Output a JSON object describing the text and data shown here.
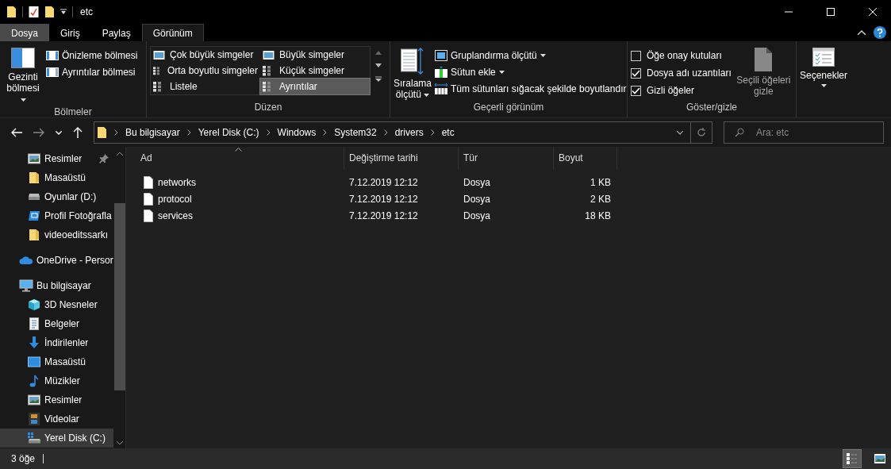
{
  "window": {
    "title": "etc"
  },
  "ribbon": {
    "tabs": [
      {
        "label": "Dosya",
        "kind": "file",
        "selected": false
      },
      {
        "label": "Giriş",
        "kind": "tab",
        "selected": false
      },
      {
        "label": "Paylaş",
        "kind": "tab",
        "selected": false
      },
      {
        "label": "Görünüm",
        "kind": "tab",
        "selected": true
      }
    ],
    "panes": {
      "label": "Bölmeler",
      "large_button": "Gezinti bölmesi",
      "buttons": [
        "Önizleme bölmesi",
        "Ayrıntılar bölmesi"
      ]
    },
    "layout": {
      "label": "Düzen",
      "options": [
        {
          "label": "Çok büyük simgeler",
          "selected": false
        },
        {
          "label": "Büyük simgeler",
          "selected": false
        },
        {
          "label": "Orta boyutlu simgeler",
          "selected": false
        },
        {
          "label": "Küçük simgeler",
          "selected": false
        },
        {
          "label": "Listele",
          "selected": false
        },
        {
          "label": "Ayrıntılar",
          "selected": true
        }
      ]
    },
    "current_view": {
      "label": "Geçerli görünüm",
      "large_button": "Sıralama ölçütü",
      "buttons": [
        {
          "label": "Gruplandırma ölçütü",
          "dropdown": true
        },
        {
          "label": "Sütun ekle",
          "dropdown": true
        },
        {
          "label": "Tüm sütunları sığacak şekilde boyutlandır",
          "dropdown": false
        }
      ]
    },
    "show_hide": {
      "label": "Göster/gizle",
      "checkboxes": [
        {
          "label": "Öğe onay kutuları",
          "checked": false
        },
        {
          "label": "Dosya adı uzantıları",
          "checked": true
        },
        {
          "label": "Gizli öğeler",
          "checked": true
        }
      ],
      "hide_button": {
        "label": "Seçili öğeleri gizle",
        "disabled": true
      }
    },
    "options_button": "Seçenekler"
  },
  "address": {
    "breadcrumbs": [
      "Bu bilgisayar",
      "Yerel Disk (C:)",
      "Windows",
      "System32",
      "drivers",
      "etc"
    ]
  },
  "search": {
    "placeholder": "Ara: etc"
  },
  "sidebar": {
    "items": [
      {
        "children": [
          {
            "label": "Resimler",
            "kind": "pictures",
            "pinned": true,
            "selected": false
          },
          {
            "label": "Masaüstü",
            "kind": "folder",
            "pinned": false,
            "selected": false
          },
          {
            "label": "Oyunlar (D:)",
            "kind": "drive",
            "pinned": false,
            "selected": false
          },
          {
            "label": "Profil Fotoğrafla",
            "kind": "shortcut",
            "pinned": false,
            "selected": false
          },
          {
            "label": "videoeditssarkı",
            "kind": "folder",
            "pinned": false,
            "selected": false
          }
        ]
      },
      {
        "label": "OneDrive - Persor",
        "kind": "cloud",
        "selected": false
      },
      {
        "label": "Bu bilgisayar",
        "kind": "computer",
        "selected": false,
        "children": [
          {
            "label": "3D Nesneler",
            "kind": "cube",
            "selected": false
          },
          {
            "label": "Belgeler",
            "kind": "documents",
            "selected": false
          },
          {
            "label": "İndirilenler",
            "kind": "downloads",
            "selected": false
          },
          {
            "label": "Masaüstü",
            "kind": "desktop",
            "selected": false
          },
          {
            "label": "Müzikler",
            "kind": "music",
            "selected": false
          },
          {
            "label": "Resimler",
            "kind": "pictures",
            "selected": false
          },
          {
            "label": "Videolar",
            "kind": "videos",
            "selected": false
          },
          {
            "label": "Yerel Disk (C:)",
            "kind": "system-drive",
            "selected": true
          }
        ]
      }
    ]
  },
  "table": {
    "columns": [
      "Ad",
      "Değiştirme tarihi",
      "Tür",
      "Boyut"
    ],
    "rows": [
      [
        "networks",
        "7.12.2019 12:12",
        "Dosya",
        "1 KB"
      ],
      [
        "protocol",
        "7.12.2019 12:12",
        "Dosya",
        "2 KB"
      ],
      [
        "services",
        "7.12.2019 12:12",
        "Dosya",
        "18 KB"
      ]
    ]
  },
  "status_bar": {
    "count": "3 öğe",
    "views": [
      {
        "kind": "details",
        "selected": true
      },
      {
        "kind": "large-icons",
        "selected": false
      }
    ]
  }
}
